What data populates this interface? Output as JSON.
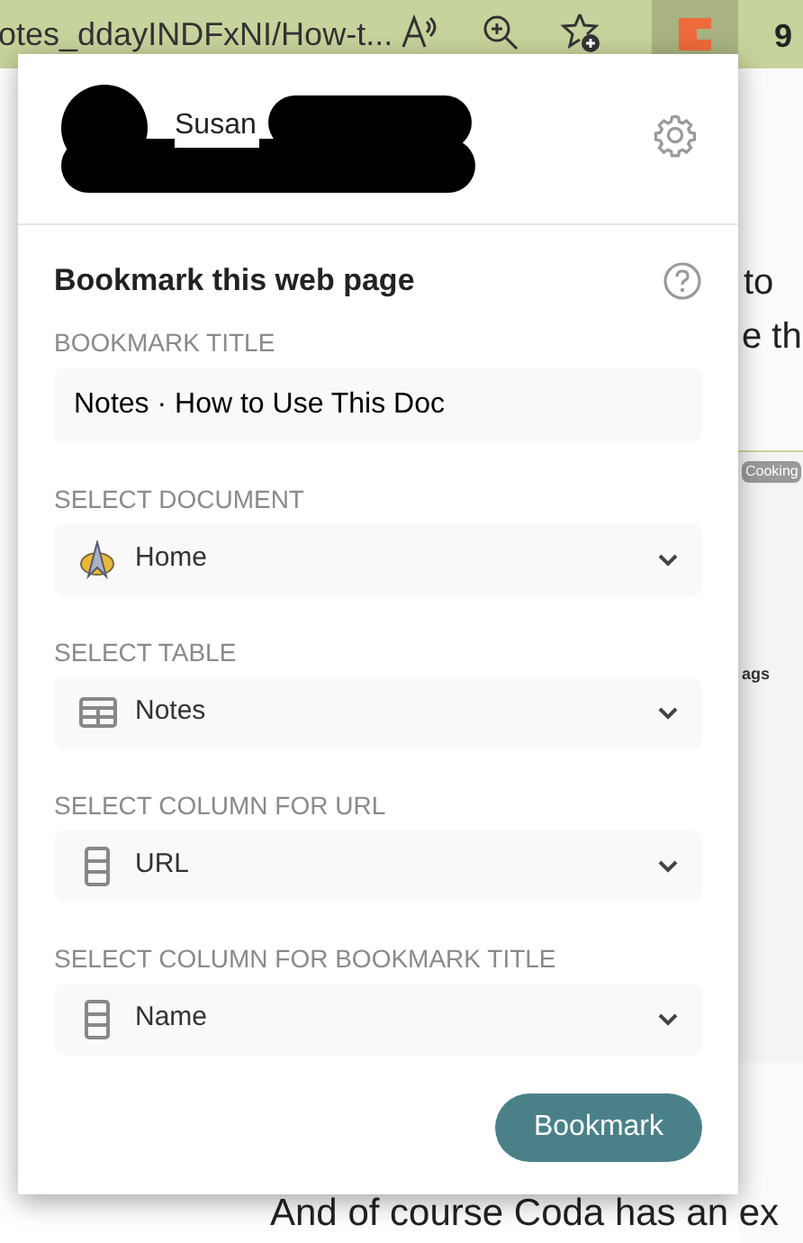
{
  "browser": {
    "address": "otes_ddayINDFxNI/How-t...",
    "zoom_text": "9"
  },
  "background_page": {
    "line_1": "to",
    "line_2": "e th",
    "chip": "Cooking",
    "column_header": "ags",
    "footer_line": "And of course Coda has an ex"
  },
  "popup": {
    "user_name": "Susan",
    "heading": "Bookmark this web page",
    "fields": [
      {
        "kind": "text",
        "label": "BOOKMARK TITLE",
        "value": "Notes · How to Use This Doc"
      },
      {
        "kind": "document",
        "label": "SELECT DOCUMENT",
        "value": "Home"
      },
      {
        "kind": "table",
        "label": "SELECT TABLE",
        "value": "Notes"
      },
      {
        "kind": "column",
        "label": "SELECT COLUMN FOR URL",
        "value": "URL"
      },
      {
        "kind": "column",
        "label": "SELECT COLUMN FOR BOOKMARK TITLE",
        "value": "Name"
      }
    ],
    "submit": "Bookmark"
  }
}
